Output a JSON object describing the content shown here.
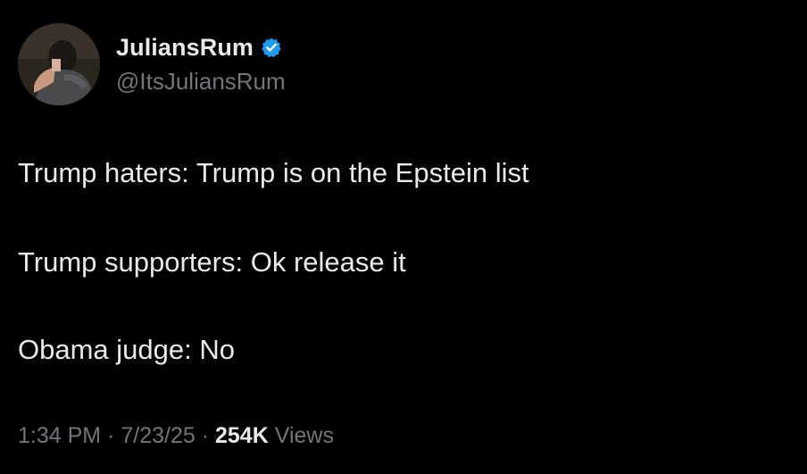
{
  "author": {
    "display_name": "JuliansRum",
    "handle": "@ItsJuliansRum",
    "verified": true,
    "avatar_icon": "profile-photo-icon",
    "verified_icon": "verified-badge-icon",
    "verified_color": "#1d9bf0"
  },
  "tweet": {
    "lines": [
      "Trump haters: Trump is on the Epstein list",
      "Trump supporters: Ok release it",
      "Obama judge: No"
    ]
  },
  "meta": {
    "time": "1:34 PM",
    "separator": "·",
    "date": "7/23/25",
    "views_count": "254K",
    "views_label": "Views"
  },
  "colors": {
    "background": "#000000",
    "primary_text": "#e7e9ea",
    "secondary_text": "#71767b"
  }
}
